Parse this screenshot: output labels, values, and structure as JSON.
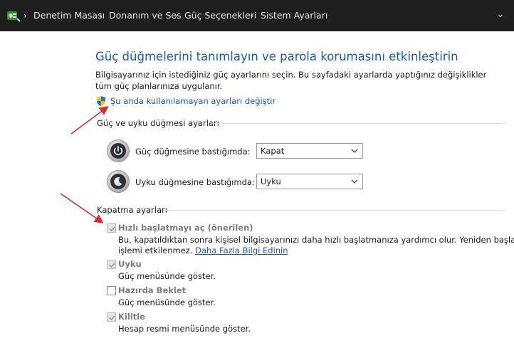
{
  "breadcrumb": {
    "items": [
      "Denetim Masası",
      "Donanım ve Ses",
      "Güç Seçenekleri",
      "Sistem Ayarları"
    ]
  },
  "page": {
    "title": "Güç düğmelerini tanımlayın ve parola korumasını etkinleştirin",
    "description": "Bilgisayarınız için istediğiniz güç ayarlarını seçin. Bu sayfadaki ayarlarda yaptığınız değişiklikler tüm güç planlarınıza uygulanır.",
    "change_unavailable_link": "Şu anda kullanılamayan ayarları değiştir"
  },
  "power_section": {
    "heading": "Güç ve uyku düğmesi ayarları",
    "power_button_label": "Güç düğmesine bastığımda:",
    "power_button_value": "Kapat",
    "sleep_button_label": "Uyku düğmesine bastığımda:",
    "sleep_button_value": "Uyku"
  },
  "shutdown_section": {
    "heading": "Kapatma ayarları",
    "fast_startup": {
      "label": "Hızlı başlatmayı aç (önerilen)",
      "desc_line1": "Bu, kapatıldıktan sonra kişisel bilgisayarınızı daha hızlı başlatmanıza yardımcı olur. Yeniden başlatma",
      "desc_line2_prefix": "işlemi etkilenmez.",
      "learn_more": "Daha Fazla Bilgi Edinin",
      "checked": true
    },
    "sleep": {
      "label": "Uyku",
      "desc": "Güç menüsünde göster.",
      "checked": true
    },
    "hibernate": {
      "label": "Hazırda Beklet",
      "desc": "Güç menüsünde göster.",
      "checked": false
    },
    "lock": {
      "label": "Kilitle",
      "desc": "Hesap resmi menüsünde göster.",
      "checked": true
    }
  },
  "colors": {
    "title_blue": "#1e5aa0",
    "link_blue": "#1a55a8",
    "addressbar_bg": "#1f1f1f",
    "annotation_red": "#d32f2f"
  }
}
